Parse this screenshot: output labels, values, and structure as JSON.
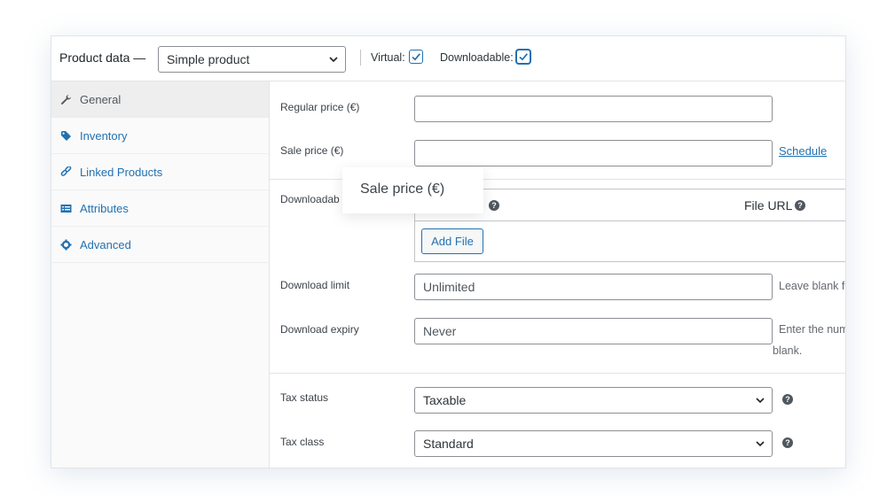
{
  "header": {
    "title": "Product data —",
    "product_type": "Simple product",
    "virtual_label": "Virtual:",
    "virtual_checked": true,
    "downloadable_label": "Downloadable:",
    "downloadable_checked": true
  },
  "sidebar": {
    "items": [
      {
        "label": "General",
        "icon": "wrench-icon",
        "active": true
      },
      {
        "label": "Inventory",
        "icon": "tag-icon",
        "active": false
      },
      {
        "label": "Linked Products",
        "icon": "link-icon",
        "active": false
      },
      {
        "label": "Attributes",
        "icon": "list-table-icon",
        "active": false
      },
      {
        "label": "Advanced",
        "icon": "gear-icon",
        "active": false
      }
    ]
  },
  "general": {
    "regular_price_label": "Regular price (€)",
    "regular_price_value": "",
    "sale_price_label": "Sale price (€)",
    "sale_price_value": "",
    "schedule_link": "Schedule",
    "downloadable_files_label": "Downloadab",
    "file_name_header": "",
    "file_url_header": "File URL",
    "add_file_button": "Add File",
    "download_limit_label": "Download limit",
    "download_limit_placeholder": "Unlimited",
    "download_limit_desc": "Leave blank f",
    "download_expiry_label": "Download expiry",
    "download_expiry_placeholder": "Never",
    "download_expiry_desc_line1": "Enter the num",
    "download_expiry_desc_line2": "blank.",
    "tax_status_label": "Tax status",
    "tax_status_value": "Taxable",
    "tax_class_label": "Tax class",
    "tax_class_value": "Standard"
  },
  "tooltip": {
    "text": "Sale price (€)"
  },
  "colors": {
    "accent": "#2271b1",
    "sidebar_bg": "#fafafa",
    "active_tab_bg": "#eeeeee"
  }
}
